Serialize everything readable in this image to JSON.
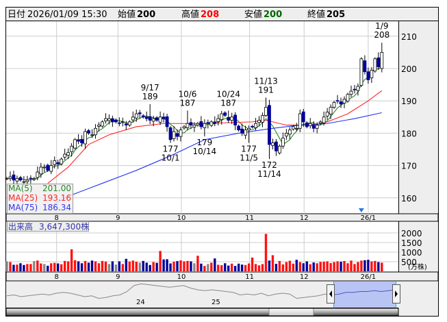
{
  "header": {
    "date_label": "日付",
    "date_value": "2026/01/09 15:30",
    "open_label": "始値",
    "open_value": "200",
    "high_label": "高値",
    "high_value": "208",
    "low_label": "安値",
    "low_value": "200",
    "close_label": "終値",
    "close_value": "205"
  },
  "legend": {
    "ma5_label": "MA(5)",
    "ma5_value": "201.00",
    "ma25_label": "MA(25)",
    "ma25_value": "193.16",
    "ma75_label": "MA(75)",
    "ma75_value": "186.34"
  },
  "volume_label": {
    "label": "出来高",
    "value": "3,647,300株"
  },
  "colors": {
    "up": "#ffffff",
    "down": "#000099",
    "ma5": "#228822",
    "ma25": "#ff2222",
    "ma75": "#2233ee",
    "vol_up": "#ff1111",
    "vol_down": "#000099",
    "vol_flat": "#888888"
  },
  "chart_data": {
    "type": "candlestick",
    "price_axis": {
      "ylim": [
        155,
        213
      ],
      "ticks": [
        "210",
        "200",
        "190",
        "180",
        "170",
        "160"
      ]
    },
    "volume_axis": {
      "ylim": [
        0,
        2150
      ],
      "ticks": [
        "2000",
        "1500",
        "1000",
        "500"
      ],
      "unit": "(万株)"
    },
    "month_ticks": [
      {
        "label": "8",
        "i": 14.6
      },
      {
        "label": "9",
        "i": 32.6
      },
      {
        "label": "10",
        "i": 51.2
      },
      {
        "label": "11",
        "i": 71.2
      },
      {
        "label": "12",
        "i": 87.2
      },
      {
        "label": "26/1",
        "i": 106
      }
    ],
    "closes": [
      166,
      166.5,
      165.5,
      166,
      165.5,
      165,
      165.5,
      166,
      166,
      168,
      169.5,
      169.5,
      168.5,
      170,
      171.5,
      170.5,
      172,
      173.5,
      174,
      176,
      178,
      177.5,
      177,
      180.5,
      180,
      179.5,
      181.5,
      182.5,
      183.5,
      184.5,
      184.5,
      183.5,
      183.5,
      183,
      183.5,
      182.5,
      183.5,
      185,
      186,
      186,
      185,
      184.5,
      184,
      184.5,
      184,
      185,
      184.5,
      182,
      178,
      180.5,
      179,
      181,
      182,
      183,
      182.5,
      182.5,
      183,
      182,
      183,
      183,
      183.5,
      183,
      184.5,
      186,
      185.5,
      184,
      185,
      182.5,
      181,
      180,
      181,
      181.5,
      182,
      183,
      184,
      185.5,
      188,
      176.5,
      177,
      174.5,
      176,
      178.5,
      180,
      181,
      182,
      181.5,
      186,
      183.5,
      182,
      183,
      181.5,
      182.5,
      183.5,
      185,
      186.5,
      188,
      189.5,
      190,
      189,
      190.5,
      192,
      193,
      193.5,
      194.5,
      203,
      199,
      196.5,
      199.5,
      203,
      200.5,
      205
    ],
    "first_open": 166,
    "last_open": 200,
    "extremes": [
      {
        "i": 42,
        "type": "high",
        "value": 189,
        "date": "9/17",
        "price": "189"
      },
      {
        "i": 48,
        "type": "low",
        "value": 177,
        "date": "10/1",
        "price": "177"
      },
      {
        "i": 53,
        "type": "high",
        "value": 187,
        "date": "10/6",
        "price": "187"
      },
      {
        "i": 58,
        "type": "low",
        "value": 179,
        "date": "10/14",
        "price": "179"
      },
      {
        "i": 65,
        "type": "high",
        "value": 187,
        "date": "10/24",
        "price": "187"
      },
      {
        "i": 71,
        "type": "low",
        "value": 177,
        "date": "11/5",
        "price": "177"
      },
      {
        "i": 76,
        "type": "high",
        "value": 191,
        "date": "11/13",
        "price": "191"
      },
      {
        "i": 77,
        "type": "low",
        "value": 172,
        "date": "11/14",
        "price": "172"
      },
      {
        "i": 110,
        "type": "high",
        "value": 208,
        "date": "1/9",
        "price": "208"
      }
    ],
    "ma25": [
      [
        12,
        164.5
      ],
      [
        18,
        169.5
      ],
      [
        24,
        176.5
      ],
      [
        30,
        179.5
      ],
      [
        38,
        182
      ],
      [
        46,
        183
      ],
      [
        58,
        183
      ],
      [
        72,
        183.5
      ],
      [
        76,
        184
      ],
      [
        82,
        182.5
      ],
      [
        90,
        182.5
      ],
      [
        94,
        183.5
      ],
      [
        100,
        186
      ],
      [
        106,
        190
      ],
      [
        110,
        193.16
      ]
    ],
    "ma75": [
      [
        13,
        157.5
      ],
      [
        18,
        160.5
      ],
      [
        28,
        164.5
      ],
      [
        38,
        168.5
      ],
      [
        48,
        173
      ],
      [
        58,
        178
      ],
      [
        68,
        180
      ],
      [
        78,
        181.5
      ],
      [
        86,
        182.5
      ],
      [
        94,
        183
      ],
      [
        102,
        184.5
      ],
      [
        110,
        186.34
      ]
    ],
    "volumes": [
      520,
      480,
      340,
      350,
      420,
      330,
      380,
      380,
      530,
      560,
      410,
      380,
      290,
      420,
      440,
      410,
      370,
      540,
      520,
      1150,
      580,
      520,
      420,
      540,
      450,
      560,
      520,
      420,
      540,
      510,
      380,
      520,
      350,
      520,
      380,
      650,
      510,
      560,
      500,
      450,
      540,
      450,
      330,
      480,
      440,
      1060,
      620,
      630,
      410,
      500,
      530,
      570,
      520,
      540,
      520,
      420,
      810,
      400,
      280,
      380,
      450,
      670,
      340,
      320,
      420,
      300,
      400,
      280,
      400,
      350,
      330,
      410,
      720,
      380,
      310,
      380,
      1950,
      560,
      840,
      390,
      540,
      360,
      480,
      550,
      400,
      600,
      480,
      420,
      520,
      370,
      460,
      420,
      490,
      500,
      520,
      430,
      480,
      520,
      500,
      540,
      420,
      560,
      380,
      480,
      560,
      580,
      600,
      520,
      540,
      480,
      450
    ],
    "marker_i": 104
  },
  "navigator": {
    "labels": [
      "24",
      "25"
    ],
    "series": [
      178,
      179,
      177,
      178,
      179,
      180,
      179,
      181,
      182,
      181,
      179,
      177,
      178,
      175,
      176,
      178,
      179,
      183,
      190,
      192,
      191,
      190,
      189,
      188,
      189,
      190,
      187,
      185,
      184,
      185,
      184,
      183,
      182,
      179,
      180,
      179,
      181,
      178,
      180,
      181,
      180,
      175,
      176,
      177,
      178,
      180,
      179,
      180,
      182,
      182,
      183,
      183,
      184,
      183,
      184,
      185
    ]
  }
}
